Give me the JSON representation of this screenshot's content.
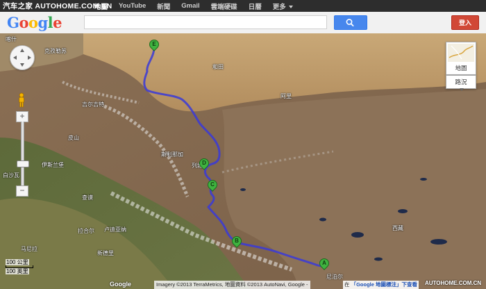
{
  "watermark": "汽车之家 AUTOHOME.COM.CN",
  "topbar": {
    "links": [
      {
        "label": "地圖",
        "active": true
      },
      {
        "label": "YouTube",
        "active": false
      },
      {
        "label": "新聞",
        "active": false
      },
      {
        "label": "Gmail",
        "active": false
      },
      {
        "label": "雲端硬碟",
        "active": false
      },
      {
        "label": "日曆",
        "active": false
      },
      {
        "label": "更多",
        "active": false
      }
    ]
  },
  "header": {
    "logo": "Google",
    "signin_label": "登入"
  },
  "map": {
    "markers": [
      "A",
      "B",
      "C",
      "D",
      "E"
    ],
    "labels": [
      "喀什",
      "克孜勒苏",
      "皮山",
      "和田",
      "阿里",
      "伊斯兰堡",
      "白沙瓦",
      "拉合尔",
      "卢迪亚纳",
      "新德里",
      "马尼拉",
      "吉尔吉特",
      "斯利那加",
      "查谟",
      "西藏",
      "尼泊尔",
      "列城"
    ],
    "maptype_label": "地圖",
    "traffic_label": "路況",
    "scale": {
      "km": "100 公里",
      "mi": "100 英里"
    },
    "attribution": "Imagery ©2013 TerraMetrics, 地圖資料 ©2013 AutoNavi, Google -",
    "bottom_link_prefix": "在",
    "bottom_link": "「Google 地圖標注」下查看",
    "bottom_watermark": "AUTOHOME.COM.CN",
    "map_logo": "Google"
  },
  "colors": {
    "route": "#3a3ad8",
    "marker": "#3fb23f",
    "signin": "#d14836",
    "search_button": "#4787ed"
  }
}
